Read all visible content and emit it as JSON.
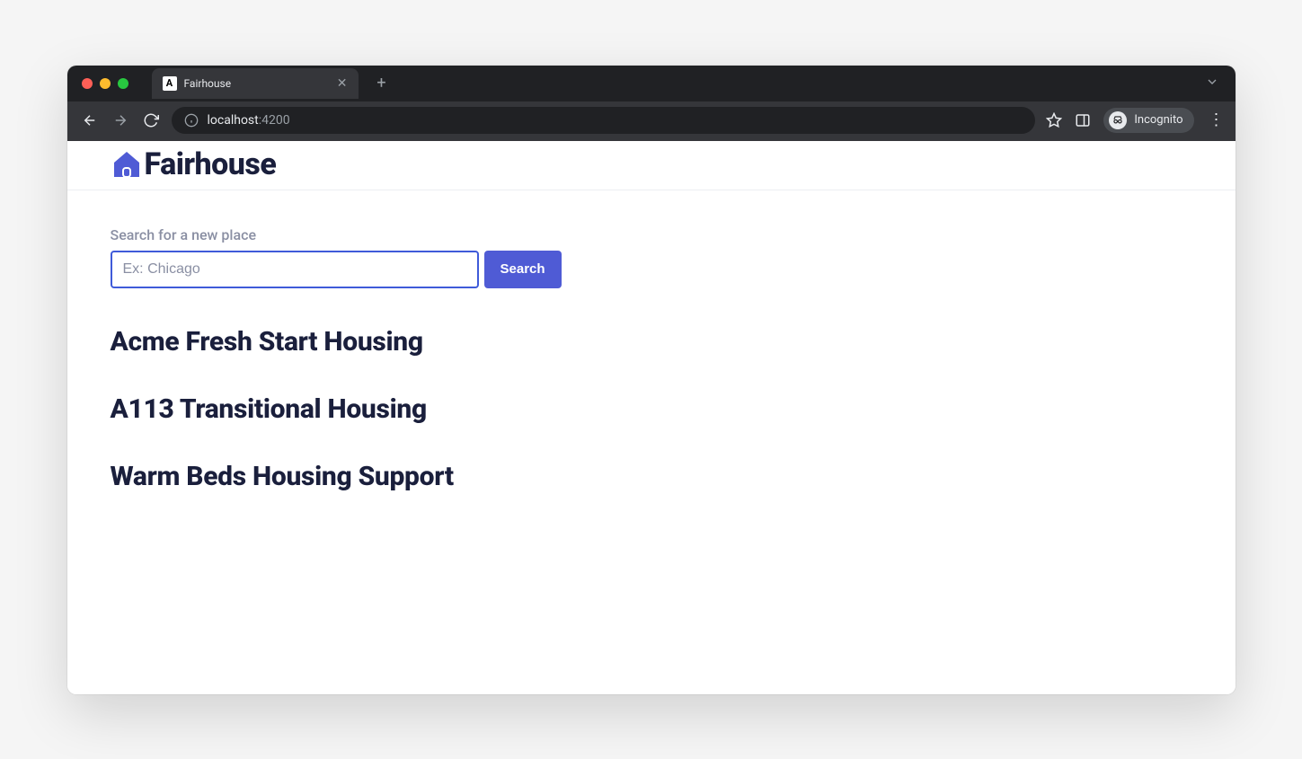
{
  "browser": {
    "tab_title": "Fairhouse",
    "url_host": "localhost",
    "url_port": ":4200",
    "incognito_label": "Incognito"
  },
  "app": {
    "title": "Fairhouse"
  },
  "search": {
    "label": "Search for a new place",
    "placeholder": "Ex: Chicago",
    "value": "",
    "button": "Search"
  },
  "results": [
    {
      "title": "Acme Fresh Start Housing"
    },
    {
      "title": "A113 Transitional Housing"
    },
    {
      "title": "Warm Beds Housing Support"
    }
  ],
  "colors": {
    "accent": "#4f5bd5",
    "text_dark": "#1a1f3c"
  }
}
